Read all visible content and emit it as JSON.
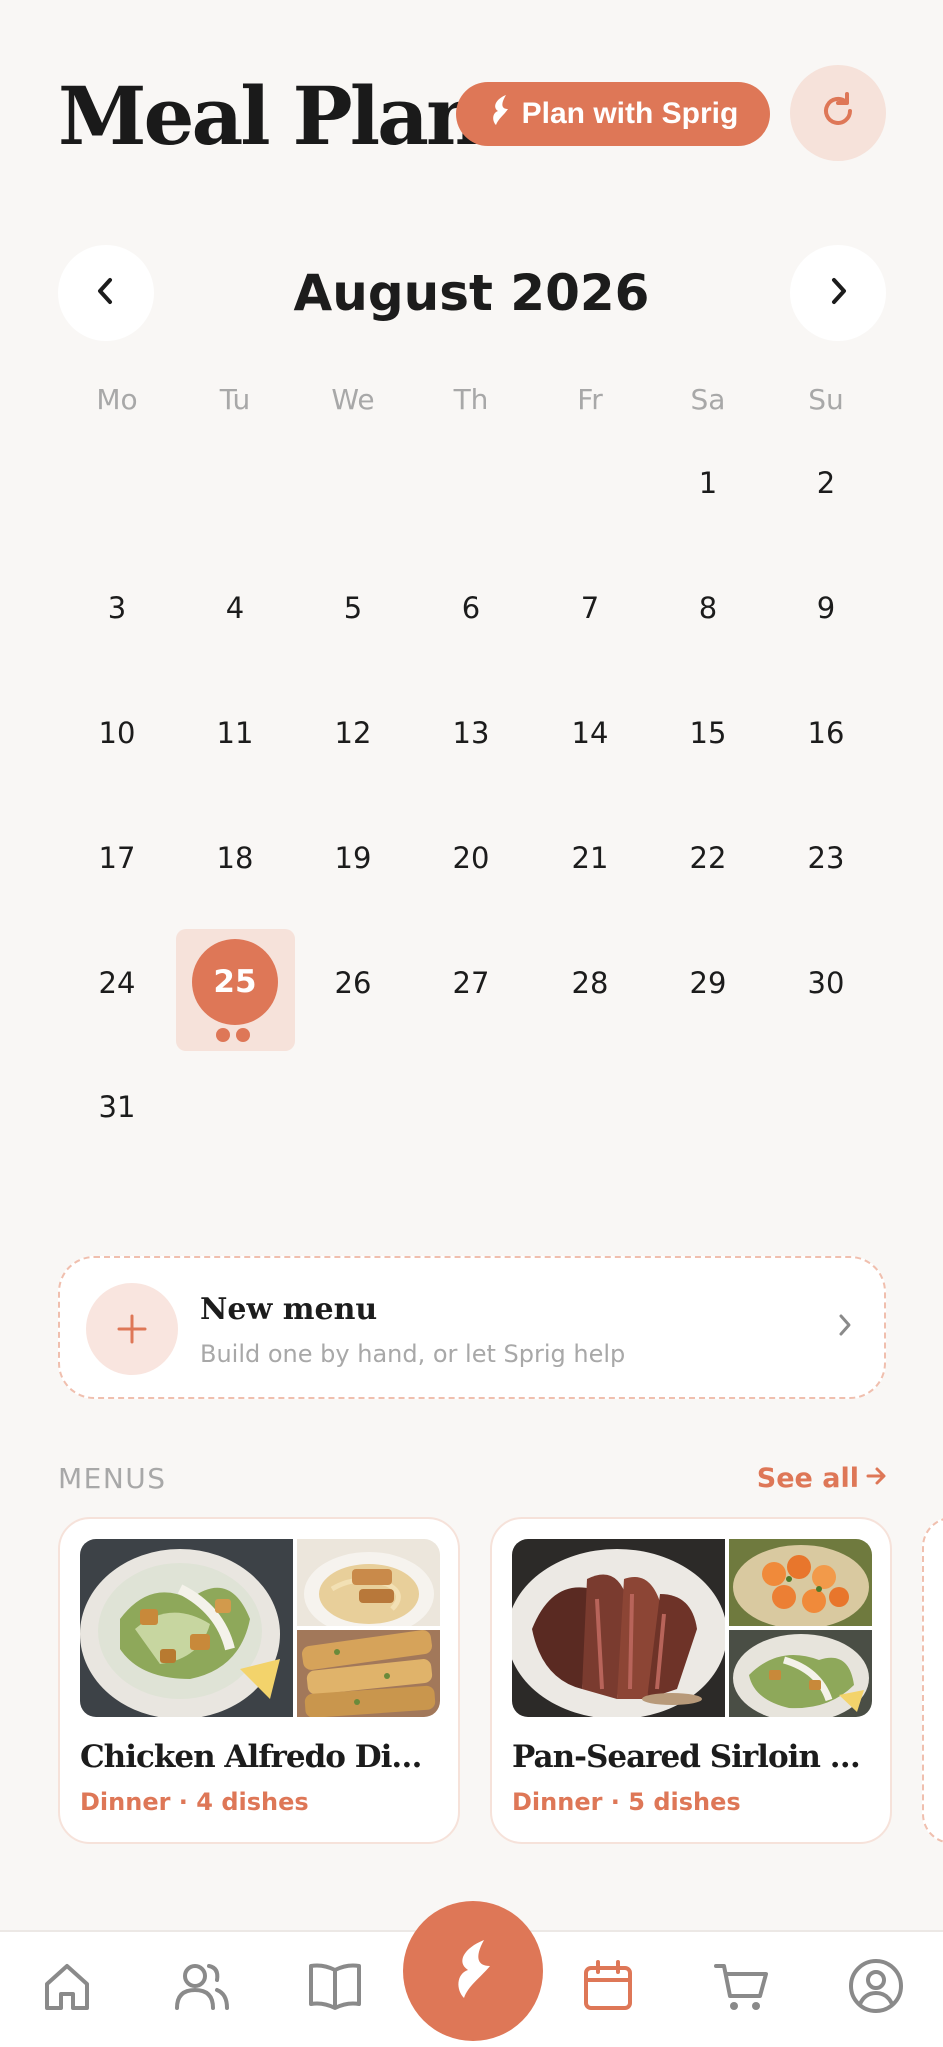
{
  "header": {
    "title": "Meal Plan",
    "plan_button_label": "Plan with Sprig",
    "plan_button_icon": "sprig-leaf-icon",
    "refresh_icon": "refresh-icon"
  },
  "calendar": {
    "month_label": "August 2026",
    "prev_icon": "chevron-left-icon",
    "next_icon": "chevron-right-icon",
    "weekdays": [
      "Mo",
      "Tu",
      "We",
      "Th",
      "Fr",
      "Sa",
      "Su"
    ],
    "days": [
      "1",
      "2",
      "3",
      "4",
      "5",
      "6",
      "7",
      "8",
      "9",
      "10",
      "11",
      "12",
      "13",
      "14",
      "15",
      "16",
      "17",
      "18",
      "19",
      "20",
      "21",
      "22",
      "23",
      "24",
      "25",
      "26",
      "27",
      "28",
      "29",
      "30",
      "31"
    ],
    "selected_day": "25",
    "selected_day_meal_dots": 2
  },
  "new_menu": {
    "title": "New menu",
    "subtitle": "Build one by hand, or let Sprig help",
    "icon": "plus-icon"
  },
  "menus": {
    "heading": "MENUS",
    "see_all": "See all",
    "see_all_icon": "arrow-right-icon",
    "items": [
      {
        "name": "Chicken Alfredo Dinn…",
        "meta": "Dinner · 4 dishes"
      },
      {
        "name": "Pan-Seared Sirloin D…",
        "meta": "Dinner · 5 dishes"
      }
    ]
  },
  "bottom_nav": {
    "items": [
      "home-icon",
      "people-icon",
      "book-icon",
      "sprig-leaf-icon",
      "calendar-icon",
      "cart-icon",
      "profile-icon"
    ],
    "active": "calendar-icon"
  },
  "colors": {
    "accent": "#de7757",
    "accent_light": "#f6e2da",
    "background": "#f9f7f5",
    "muted_text": "#a8a8a8"
  }
}
